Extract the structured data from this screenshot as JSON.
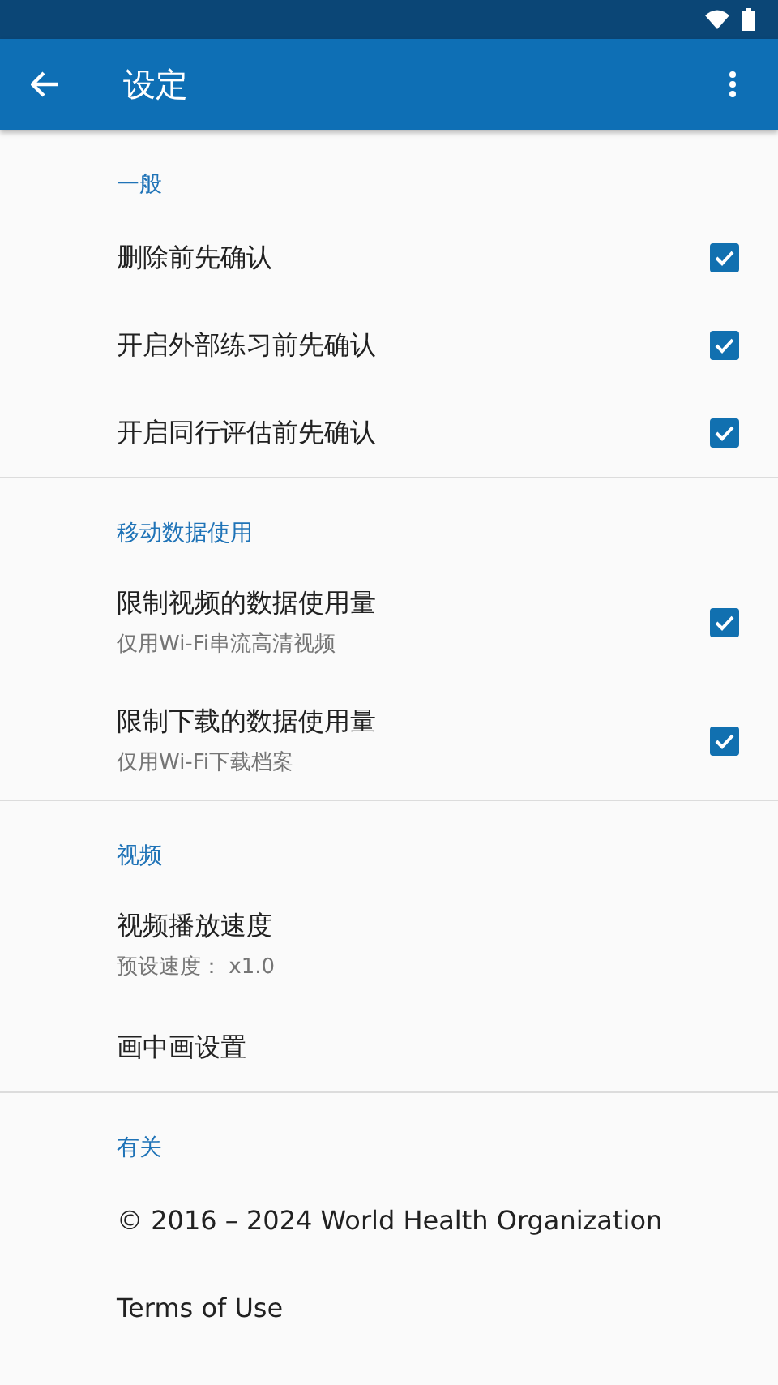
{
  "app_bar": {
    "title": "设定"
  },
  "sections": [
    {
      "title": "一般",
      "items": [
        {
          "kind": "checkbox",
          "title": "删除前先确认",
          "checked": true
        },
        {
          "kind": "checkbox",
          "title": "开启外部练习前先确认",
          "checked": true
        },
        {
          "kind": "checkbox",
          "title": "开启同行评估前先确认",
          "checked": true
        }
      ]
    },
    {
      "title": "移动数据使用",
      "items": [
        {
          "kind": "checkbox",
          "title": "限制视频的数据使用量",
          "subtitle": "仅用Wi-Fi串流高清视频",
          "checked": true
        },
        {
          "kind": "checkbox",
          "title": "限制下载的数据使用量",
          "subtitle": "仅用Wi-Fi下载档案",
          "checked": true
        }
      ]
    },
    {
      "title": "视频",
      "items": [
        {
          "kind": "plain",
          "title": "视频播放速度",
          "subtitle": "预设速度： x1.0"
        },
        {
          "kind": "plain",
          "title": "画中画设置"
        }
      ]
    },
    {
      "title": "有关",
      "items": [
        {
          "kind": "plain",
          "title": "© 2016 – 2024 World Health Organization"
        },
        {
          "kind": "plain",
          "title": "Terms of Use"
        }
      ]
    }
  ]
}
